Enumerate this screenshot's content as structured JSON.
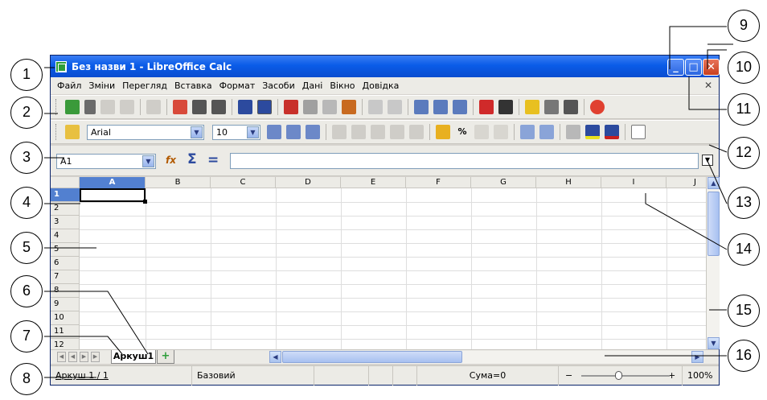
{
  "window": {
    "title": "Без назви 1 - LibreOffice Calc",
    "minimize_glyph": "_",
    "maximize_glyph": "□",
    "close_glyph": "✕"
  },
  "menu": {
    "items": [
      "Файл",
      "Зміни",
      "Перегляд",
      "Вставка",
      "Формат",
      "Засоби",
      "Дані",
      "Вікно",
      "Довідка"
    ],
    "close_doc_glyph": "✕"
  },
  "format_toolbar": {
    "font_name": "Arial",
    "font_size": "10",
    "percent_label": "%"
  },
  "formula_bar": {
    "name_box": "A1",
    "function_wizard_label": "fx",
    "sum_label": "Σ",
    "formula_label": "=",
    "input_value": ""
  },
  "grid": {
    "columns": [
      "A",
      "B",
      "C",
      "D",
      "E",
      "F",
      "G",
      "H",
      "I",
      "J"
    ],
    "rows": [
      "1",
      "2",
      "3",
      "4",
      "5",
      "6",
      "7",
      "8",
      "9",
      "10",
      "11",
      "12"
    ],
    "selected_cell": "A1"
  },
  "sheets": {
    "tabs": [
      "Аркуш1"
    ],
    "add_glyph": "+"
  },
  "status": {
    "sheet_position": "Аркуш 1 / 1",
    "page_style": "Базовий",
    "sum": "Сума=0",
    "zoom_minus": "−",
    "zoom_plus": "+",
    "zoom": "100%"
  },
  "callouts": [
    "1",
    "2",
    "3",
    "4",
    "5",
    "6",
    "7",
    "8",
    "9",
    "10",
    "11",
    "12",
    "13",
    "14",
    "15",
    "16"
  ]
}
